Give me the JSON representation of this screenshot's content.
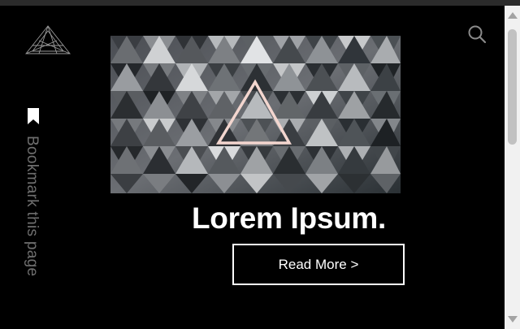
{
  "nav": {
    "logo_icon": "pyramid-logo-icon",
    "search_icon": "search-icon"
  },
  "sidebar": {
    "bookmark_icon": "bookmark-icon",
    "bookmark_label": "Bookmark this page"
  },
  "hero": {
    "image_icon": "triangle-mosaic-image",
    "headline": "Lorem Ipsum.",
    "cta_label": "Read More >"
  },
  "colors": {
    "background": "#000000",
    "text": "#ffffff",
    "sidebar_text": "#6f6f6f",
    "accent_triangle": "#f3d6cf",
    "scrollbar_track": "#f1f1f1",
    "scrollbar_thumb": "#c1c1c1"
  }
}
